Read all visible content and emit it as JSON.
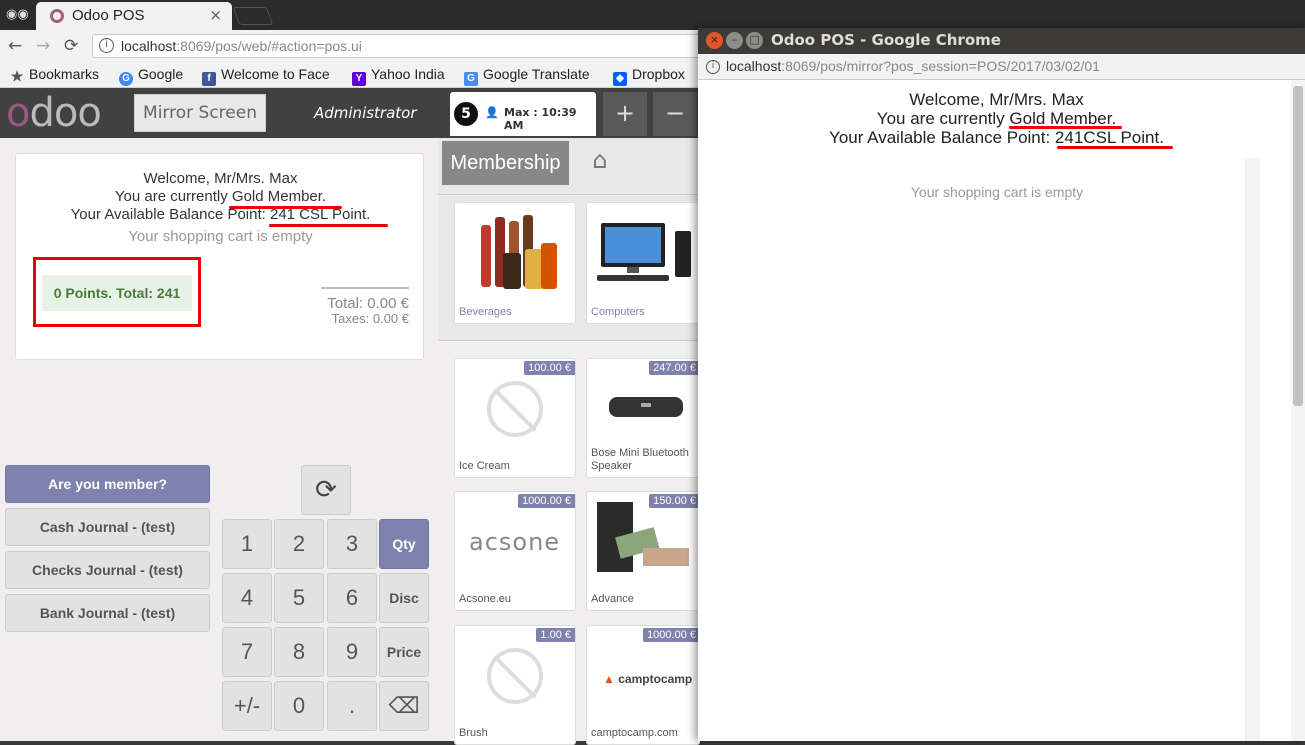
{
  "browser": {
    "tab_title": "Odoo POS",
    "close_glyph": "×",
    "url_host": "localhost",
    "url_rest": ":8069/pos/web/#action=pos.ui",
    "bookmarks": [
      {
        "label": "Bookmarks",
        "icon": "star-icon"
      },
      {
        "label": "Google",
        "icon": "google-icon"
      },
      {
        "label": "Welcome to Face",
        "icon": "facebook-icon"
      },
      {
        "label": "Yahoo India",
        "icon": "yahoo-icon"
      },
      {
        "label": "Google Translate",
        "icon": "translate-icon"
      },
      {
        "label": "Dropbox",
        "icon": "dropbox-icon"
      }
    ]
  },
  "pos": {
    "logo_text": "odoo",
    "mirror_button": "Mirror Screen",
    "user": "Administrator",
    "order_tab": {
      "number": "5",
      "label": "Max : 10:39 AM"
    },
    "add_glyph": "+",
    "remove_glyph": "−",
    "order": {
      "welcome": "Welcome, Mr/Mrs. Max",
      "membership": "You are currently Gold Member.",
      "balance": "Your Available Balance Point: 241 CSL Point.",
      "empty": "Your shopping cart is empty",
      "points": "0 Points. Total: 241",
      "total": "Total: 0.00 €",
      "taxes": "Taxes: 0.00 €"
    },
    "payment_buttons": [
      "Are you member?",
      "Cash Journal - (test)",
      "Checks Journal - (test)",
      "Bank Journal - (test)"
    ],
    "numpad": {
      "digits": [
        "1",
        "2",
        "3",
        "4",
        "5",
        "6",
        "7",
        "8",
        "9",
        "+/-",
        "0",
        "."
      ],
      "modes": [
        "Qty",
        "Disc",
        "Price"
      ],
      "backspace": "⌫",
      "refresh": "⟳"
    },
    "category_tab": "Membership",
    "home_glyph": "⌂",
    "categories": [
      "Beverages",
      "Computers"
    ],
    "products": [
      {
        "name": "Ice Cream",
        "price": "100.00 €"
      },
      {
        "name": "Bose Mini Bluetooth Speaker",
        "price": "247.00 €"
      },
      {
        "name": "Acsone.eu",
        "price": "1000.00 €"
      },
      {
        "name": "Advance",
        "price": "150.00 €"
      },
      {
        "name": "Brush",
        "price": "1.00 €"
      },
      {
        "name": "camptocamp.com",
        "price": "1000.00 €"
      }
    ],
    "logo_acsone": "acsone",
    "logo_camptocamp": "camptocamp"
  },
  "popup": {
    "title": "Odoo POS - Google Chrome",
    "url_host": "localhost",
    "url_rest": ":8069/pos/mirror?pos_session=POS/2017/03/02/01",
    "welcome": "Welcome, Mr/Mrs. Max",
    "membership": "You are currently Gold Member.",
    "balance": "Your Available Balance Point: 241CSL Point.",
    "empty": "Your shopping cart is empty",
    "close_glyph": "×",
    "minimize_glyph": "–",
    "maximize_glyph": "□"
  }
}
